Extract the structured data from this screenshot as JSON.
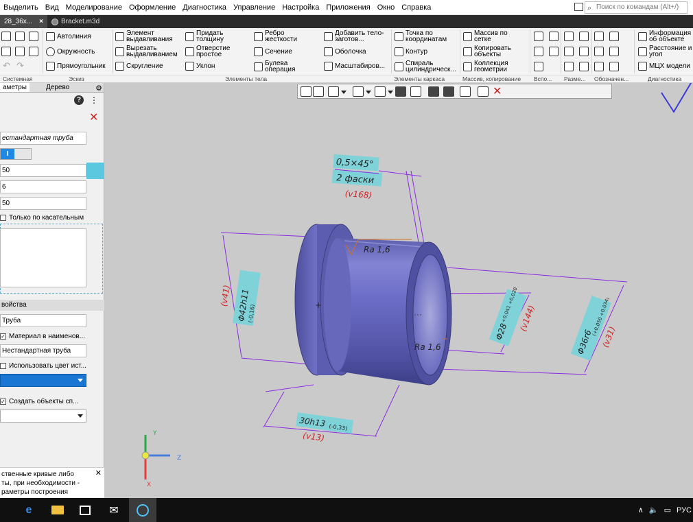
{
  "menu": {
    "items": [
      "Выделить",
      "Вид",
      "Моделирование",
      "Оформление",
      "Диагностика",
      "Управление",
      "Настройка",
      "Приложения",
      "Окно",
      "Справка"
    ],
    "search_placeholder": "Поиск по командам (Alt+/)"
  },
  "tabs": [
    {
      "label": "28_36x...",
      "active": true,
      "close": "×"
    },
    {
      "label": "Bracket.m3d",
      "active": false
    }
  ],
  "ribbon": {
    "buttons": [
      {
        "label": "Автолиния"
      },
      {
        "label": "Окружность"
      },
      {
        "label": "Прямоугольник"
      },
      {
        "label": "Элемент выдавливания"
      },
      {
        "label": "Вырезать выдавливанием"
      },
      {
        "label": "Скругление"
      },
      {
        "label": "Придать толщину"
      },
      {
        "label": "Отверстие простое"
      },
      {
        "label": "Уклон"
      },
      {
        "label": "Ребро жесткости"
      },
      {
        "label": "Сечение"
      },
      {
        "label": "Булева операция"
      },
      {
        "label": "Добавить тело-заготов..."
      },
      {
        "label": "Оболочка"
      },
      {
        "label": "Масштабиров..."
      },
      {
        "label": "Точка по координатам"
      },
      {
        "label": "Контур"
      },
      {
        "label": "Спираль цилиндрическ..."
      },
      {
        "label": "Массив по сетке"
      },
      {
        "label": "Копировать объекты"
      },
      {
        "label": "Коллекция геометрии"
      },
      {
        "label": "Информация об объекте"
      },
      {
        "label": "Расстояние и угол"
      },
      {
        "label": "МЦХ модели"
      }
    ],
    "groups": [
      "Системная",
      "Эскиз",
      "Элементы тела",
      "Элементы каркаса",
      "Массив, копирование",
      "Вспо...",
      "Разме...",
      "Обозначен...",
      "Диагностика"
    ]
  },
  "panel": {
    "tab_params": "аметры",
    "tab_tree": "Дерево",
    "name_field": "естандартная труба",
    "toggle_label": "I",
    "field1": "50",
    "field2": "6",
    "field3": "50",
    "only_tangent": "Только по касательным",
    "props_header": "войства",
    "designation": "Труба",
    "material_in_name": "Материал в наименов...",
    "name": "Нестандартная труба",
    "use_color": "Использовать цвет ист...",
    "create_objects": "Создать объекты сп...",
    "hint_lines": [
      "ственные кривые либо",
      "ты, при необходимости -",
      "раметры построения"
    ]
  },
  "drawing": {
    "chamfer": "0,5×45°",
    "chamfer_count": "2 фаски",
    "chamfer_ref": "(v168)",
    "roughness_outer": "Ra 1,6",
    "roughness_inner": "Ra 1,6",
    "dia_flange": "Φ42h11",
    "dia_flange_tol": "(-0,16)",
    "dia_flange_ref": "(v41)",
    "dia_bore": "Φ28",
    "dia_bore_tol": "+0,041 +0,020",
    "dia_bore_ref": "(v144)",
    "dia_outer": "Φ36r6",
    "dia_outer_tol": "(+0,050 +0,034)",
    "dia_outer_ref": "(v31)",
    "length": "30h13",
    "length_tol": "(-0,33)",
    "length_ref": "(v13)",
    "axis_x": "X",
    "axis_y": "Y",
    "axis_z": "Z"
  },
  "taskbar": {
    "language": "РУС"
  },
  "colors": {
    "part": "#6e6fc4",
    "dim": "#8a2be2",
    "ref": "#d42020",
    "label_bg": "#7fd3d8"
  }
}
